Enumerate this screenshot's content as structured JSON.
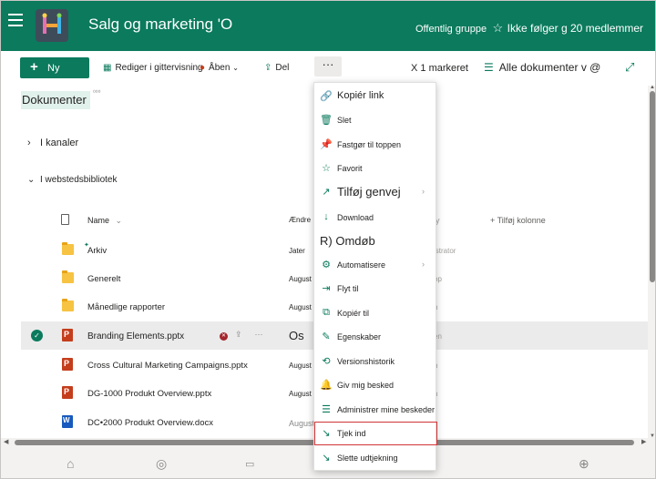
{
  "header": {
    "site_title": "Salg og marketing 'O",
    "group_type": "Offentlig gruppe",
    "follow_text": "Ikke følger g 20 medlemmer",
    "brand_color": "#0b7a5d"
  },
  "command_bar": {
    "new_label": "Ny",
    "edit_grid_label": "Rediger i gittervisning",
    "open_label": "Åben",
    "share_label": "Del",
    "more_label": "···",
    "selected_count": "X 1 markeret",
    "view_label": "Alle dokumenter v @"
  },
  "library": {
    "title": "Dokumenter",
    "title_edit_hint": "⁰⁰⁰",
    "section_channels": "I kanaler",
    "section_site": "I webstedsbibliotek",
    "columns": {
      "name": "Name",
      "modified": "Ændre",
      "modified_by_fragment": "y",
      "add_column": "Tilføj kolonne"
    },
    "rows": [
      {
        "name": "Arkiv",
        "type": "folder",
        "modified": "Jater",
        "by": "istrator",
        "selected": false
      },
      {
        "name": "Generelt",
        "type": "folder",
        "modified": "August",
        "by": "pp",
        "selected": false
      },
      {
        "name": "Månedlige rapporter",
        "type": "folder",
        "modified": "August",
        "by": "n",
        "selected": false
      },
      {
        "name": "Branding Elements.pptx",
        "type": "pptx",
        "modified": "Os",
        "by": "en",
        "selected": true
      },
      {
        "name": "Cross Cultural Marketing Campaigns.pptx",
        "type": "pptx",
        "modified": "August",
        "by": "n",
        "selected": false
      },
      {
        "name": "DG-1000 Produkt Overview.pptx",
        "type": "pptx",
        "modified": "August",
        "by": "n",
        "selected": false
      },
      {
        "name": "DC•2000 Produkt Overview.docx",
        "type": "docx",
        "modified": "August",
        "by": "n",
        "selected": false
      }
    ]
  },
  "context_menu": {
    "items": [
      {
        "label": "Kopiér link",
        "icon": "link-icon",
        "glyph": "🔗",
        "size": "med",
        "submenu": false,
        "highlight": false
      },
      {
        "label": "Slet",
        "icon": "trash-icon",
        "glyph": "🗑",
        "size": "small",
        "submenu": false,
        "highlight": false
      },
      {
        "label": "Fastgør til toppen",
        "icon": "pin-icon",
        "glyph": "📌",
        "size": "small",
        "submenu": false,
        "highlight": false
      },
      {
        "label": "Favorit",
        "icon": "star-icon",
        "glyph": "☆",
        "size": "small",
        "submenu": false,
        "highlight": false
      },
      {
        "label": "Tilføj genvej",
        "icon": "shortcut-icon",
        "glyph": "↗",
        "size": "big",
        "submenu": true,
        "highlight": false
      },
      {
        "label": "Download",
        "icon": "download-icon",
        "glyph": "↓",
        "size": "small",
        "submenu": false,
        "highlight": false
      },
      {
        "label": "R) Omdøb",
        "icon": "",
        "glyph": "",
        "size": "big-noicon",
        "submenu": false,
        "highlight": false
      },
      {
        "label": "Automatisere",
        "icon": "automate-icon",
        "glyph": "⚙",
        "size": "small",
        "submenu": true,
        "highlight": false
      },
      {
        "label": "Flyt til",
        "icon": "move-icon",
        "glyph": "⇥",
        "size": "small",
        "submenu": false,
        "highlight": false
      },
      {
        "label": "Kopiér til",
        "icon": "copy-icon",
        "glyph": "⧉",
        "size": "small",
        "submenu": false,
        "highlight": false
      },
      {
        "label": "Egenskaber",
        "icon": "edit-icon",
        "glyph": "✎",
        "size": "small",
        "submenu": false,
        "highlight": false
      },
      {
        "label": "Versionshistorik",
        "icon": "history-icon",
        "glyph": "⟲",
        "size": "small",
        "submenu": false,
        "highlight": false
      },
      {
        "label": "Giv mig besked",
        "icon": "bell-icon",
        "glyph": "🔔",
        "size": "small",
        "submenu": false,
        "highlight": false
      },
      {
        "label": "Administrer mine beskeder",
        "icon": "manage-alerts-icon",
        "glyph": "☰",
        "size": "small",
        "submenu": false,
        "highlight": false
      },
      {
        "label": "Tjek ind",
        "icon": "check-in-icon",
        "glyph": "↘",
        "size": "small",
        "submenu": false,
        "highlight": true
      },
      {
        "label": "Slette udtjekning",
        "icon": "discard-checkout-icon",
        "glyph": "↘",
        "size": "small",
        "submenu": false,
        "highlight": false
      }
    ]
  }
}
